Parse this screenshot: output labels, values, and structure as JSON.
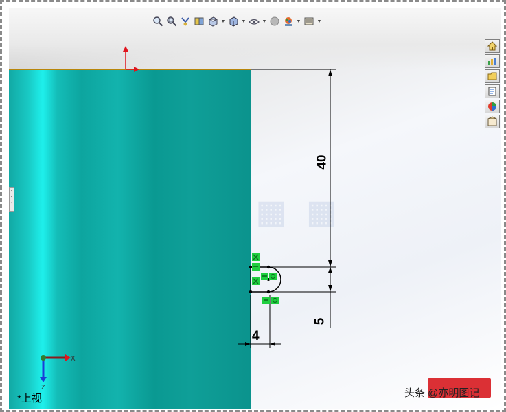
{
  "toolbar": {
    "icons": [
      "zoom-to-fit-icon",
      "zoom-area-icon",
      "previous-view-icon",
      "section-view-icon",
      "view-orientation-icon",
      "display-style-icon",
      "hide-show-items-icon",
      "edit-appearance-icon",
      "apply-scene-icon",
      "view-settings-icon"
    ]
  },
  "side_panel": {
    "icons": [
      "home-icon",
      "resources-icon",
      "design-library-icon",
      "file-explorer-icon",
      "appearances-icon",
      "custom-properties-icon"
    ]
  },
  "dimensions": {
    "d40": "40",
    "d5": "5",
    "d4": "4"
  },
  "triad": {
    "x_label": "X",
    "z_label": "Z"
  },
  "view_label": "*上视",
  "watermark": {
    "text": "头条 @亦明图记"
  },
  "colors": {
    "part_teal": "#0da59f",
    "sketch_green": "#1fcf3f",
    "axis_red": "#e0141e",
    "axis_blue": "#1a3fd6"
  }
}
